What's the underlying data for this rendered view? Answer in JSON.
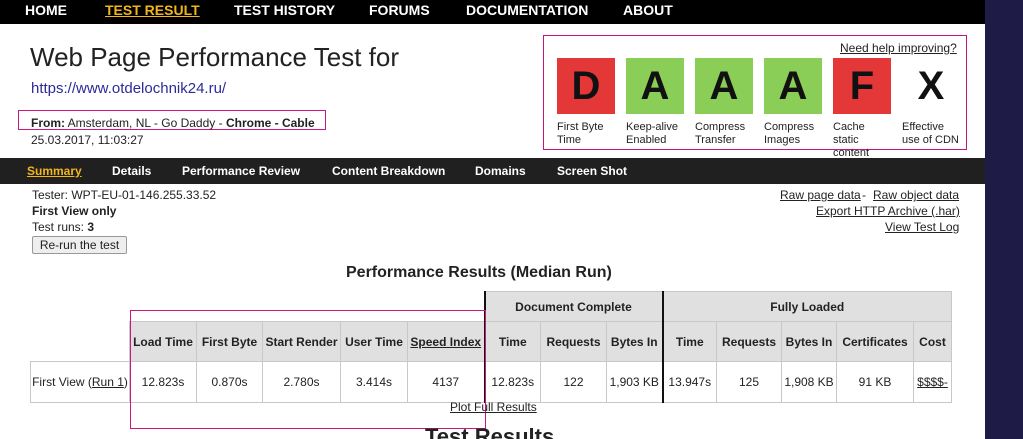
{
  "topnav": [
    "HOME",
    "TEST RESULT",
    "TEST HISTORY",
    "FORUMS",
    "DOCUMENTATION",
    "ABOUT"
  ],
  "header": {
    "title": "Web Page Performance Test for",
    "url": "https://www.otdelochnik24.ru/",
    "from_label": "From:",
    "from_location": "Amsterdam, NL - Go Daddy - ",
    "from_browser": "Chrome - Cable",
    "date": "25.03.2017, 11:03:27"
  },
  "grades": {
    "help_link": "Need help improving?",
    "items": [
      {
        "grade": "D",
        "label": "First Byte Time",
        "color": "#e43838"
      },
      {
        "grade": "A",
        "label": "Keep-alive Enabled",
        "color": "#8acd57"
      },
      {
        "grade": "A",
        "label": "Compress Transfer",
        "color": "#8acd57"
      },
      {
        "grade": "A",
        "label": "Compress Images",
        "color": "#8acd57"
      },
      {
        "grade": "F",
        "label": "Cache static content",
        "color": "#e43838"
      },
      {
        "grade": "X",
        "label": "Effective use of CDN",
        "color": ""
      }
    ]
  },
  "subnav": [
    "Summary",
    "Details",
    "Performance Review",
    "Content Breakdown",
    "Domains",
    "Screen Shot"
  ],
  "info": {
    "tester": "Tester: WPT-EU-01-146.255.33.52",
    "first_view_only": "First View only",
    "test_runs_label": "Test runs: ",
    "test_runs_value": "3",
    "rerun_button": "Re-run the test"
  },
  "raw_links": {
    "raw_page": "Raw page data",
    "sep": " - ",
    "raw_object": "Raw object data",
    "export_har": "Export HTTP Archive (.har)",
    "view_log": "View Test Log"
  },
  "results": {
    "title": "Performance Results (Median Run)",
    "group_headers": [
      "Document Complete",
      "Fully Loaded"
    ],
    "col_load_time": "Load Time",
    "col_first_byte": "First Byte",
    "col_start_render": "Start Render",
    "col_user_time": "User Time",
    "col_speed_index": "Speed Index",
    "col_dc_time": "Time",
    "col_dc_requests": "Requests",
    "col_dc_bytes": "Bytes In",
    "col_fl_time": "Time",
    "col_fl_requests": "Requests",
    "col_fl_bytes": "Bytes In",
    "col_certificates": "Certificates",
    "col_cost": "Cost",
    "row_label": "First View (",
    "row_link": "Run 1",
    "row_close": ")",
    "load_time": "12.823s",
    "first_byte": "0.870s",
    "start_render": "2.780s",
    "user_time": "3.414s",
    "speed_index": "4137",
    "dc_time": "12.823s",
    "dc_requests": "122",
    "dc_bytes": "1,903 KB",
    "fl_time": "13.947s",
    "fl_requests": "125",
    "fl_bytes": "1,908 KB",
    "certificates": "91 KB",
    "cost": "$$$$-"
  },
  "plot_link": "Plot Full Results",
  "test_results_title": "Test Results"
}
